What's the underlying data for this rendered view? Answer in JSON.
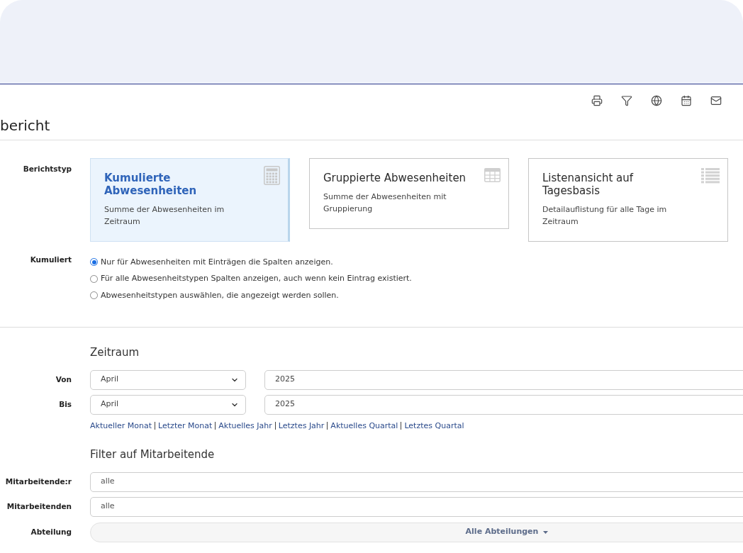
{
  "page_title": "bericht",
  "report_type": {
    "label": "Berichtstyp",
    "options": [
      {
        "title": "Kumulierte Abwesenheiten",
        "description": "Summe der Abwesenheiten im Zeitraum",
        "selected": true
      },
      {
        "title": "Gruppierte Abwesenheiten",
        "description": "Summe der Abwesenheiten mit Gruppierung",
        "selected": false
      },
      {
        "title": "Listenansicht auf Tagesbasis",
        "description": "Detailauflistung für alle Tage im Zeitraum",
        "selected": false
      }
    ]
  },
  "cumulated": {
    "label": "Kumuliert",
    "options": [
      {
        "label": "Nur für Abwesenheiten mit Einträgen die Spalten anzeigen.",
        "selected": true
      },
      {
        "label": "Für alle Abwesenheitstypen Spalten anzeigen, auch wenn kein Eintrag existiert.",
        "selected": false
      },
      {
        "label": "Abwesenheitstypen auswählen, die angezeigt werden sollen.",
        "selected": false
      }
    ]
  },
  "period": {
    "heading": "Zeitraum",
    "rows": [
      {
        "label": "Von",
        "month": "April",
        "year": "2025"
      },
      {
        "label": "Bis",
        "month": "April",
        "year": "2025"
      }
    ],
    "shortcuts": [
      "Aktueller Monat",
      "Letzter Monat",
      "Aktuelles Jahr",
      "Letztes Jahr",
      "Aktuelles Quartal",
      "Letztes Quartal"
    ]
  },
  "employee_filter": {
    "heading": "Filter auf Mitarbeitende",
    "fields": [
      {
        "label": "Mitarbeitende:r",
        "value": "alle"
      },
      {
        "label": "Mitarbeitenden",
        "value": "alle"
      }
    ],
    "department": {
      "label": "Abteilung",
      "value": "Alle Abteilungen"
    }
  }
}
